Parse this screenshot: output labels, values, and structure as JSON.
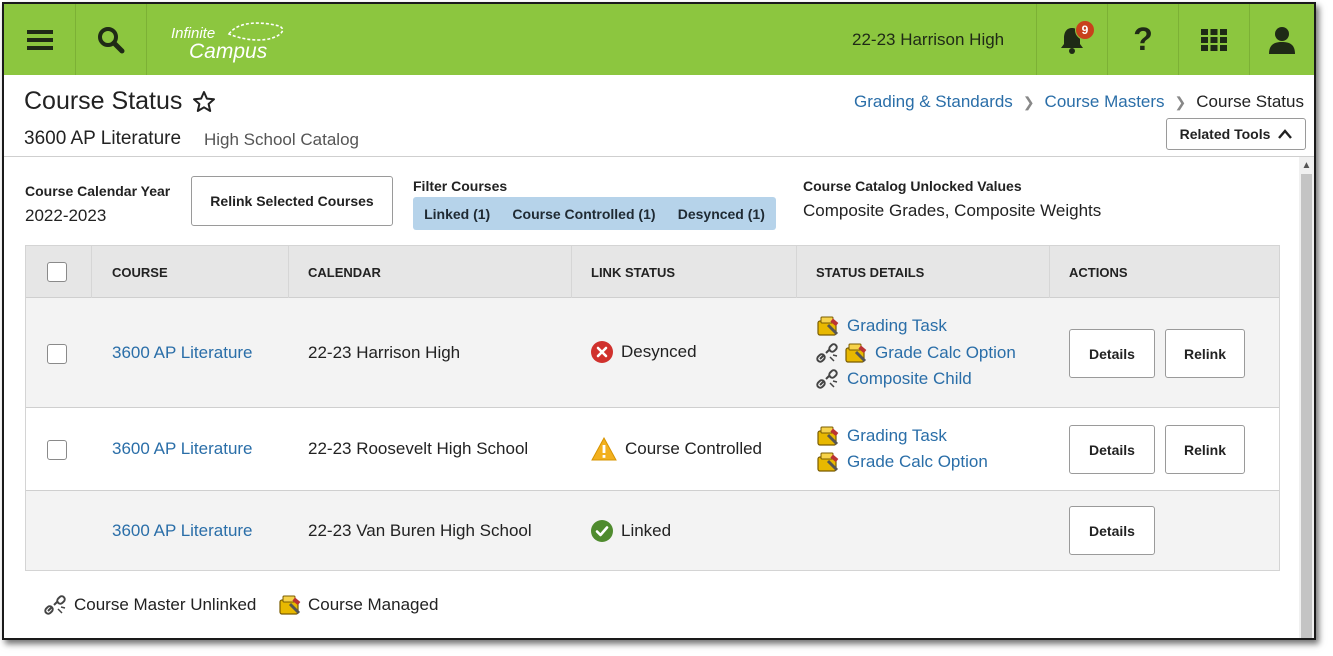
{
  "topbar": {
    "logo_line1": "Infinite",
    "logo_line2": "Campus",
    "school": "22-23 Harrison High",
    "notification_count": "9",
    "help_label": "?"
  },
  "header": {
    "title": "Course Status",
    "course": "3600 AP Literature",
    "catalog": "High School Catalog",
    "breadcrumbs": [
      "Grading & Standards",
      "Course Masters",
      "Course Status"
    ],
    "related_tools": "Related Tools"
  },
  "filters": {
    "calendar_year_label": "Course Calendar Year",
    "calendar_year_value": "2022-2023",
    "relink_selected": "Relink Selected Courses",
    "filter_label": "Filter Courses",
    "chips": [
      "Linked (1)",
      "Course Controlled (1)",
      "Desynced (1)"
    ],
    "unlocked_label": "Course Catalog Unlocked Values",
    "unlocked_value": "Composite Grades, Composite Weights"
  },
  "table": {
    "headers": [
      "COURSE",
      "CALENDAR",
      "LINK STATUS",
      "STATUS DETAILS",
      "ACTIONS"
    ],
    "rows": [
      {
        "course": "3600 AP Literature",
        "calendar": "22-23 Harrison High",
        "status": "Desynced",
        "details": [
          "Grading Task",
          "Grade Calc Option",
          "Composite Child"
        ],
        "actions": [
          "Details",
          "Relink"
        ]
      },
      {
        "course": "3600 AP Literature",
        "calendar": "22-23 Roosevelt High School",
        "status": "Course Controlled",
        "details": [
          "Grading Task",
          "Grade Calc Option"
        ],
        "actions": [
          "Details",
          "Relink"
        ]
      },
      {
        "course": "3600 AP Literature",
        "calendar": "22-23 Van Buren High School",
        "status": "Linked",
        "details": [],
        "actions": [
          "Details"
        ]
      }
    ]
  },
  "legend": {
    "unlinked": "Course Master Unlinked",
    "managed": "Course Managed"
  },
  "colors": {
    "brand_green": "#8cc63f",
    "link_blue": "#2a6ea8",
    "desynced_red": "#d0312d",
    "controlled_yellow": "#f2b01e",
    "linked_green": "#4f8b2e",
    "filter_chip_bg": "#b6d3ea"
  }
}
